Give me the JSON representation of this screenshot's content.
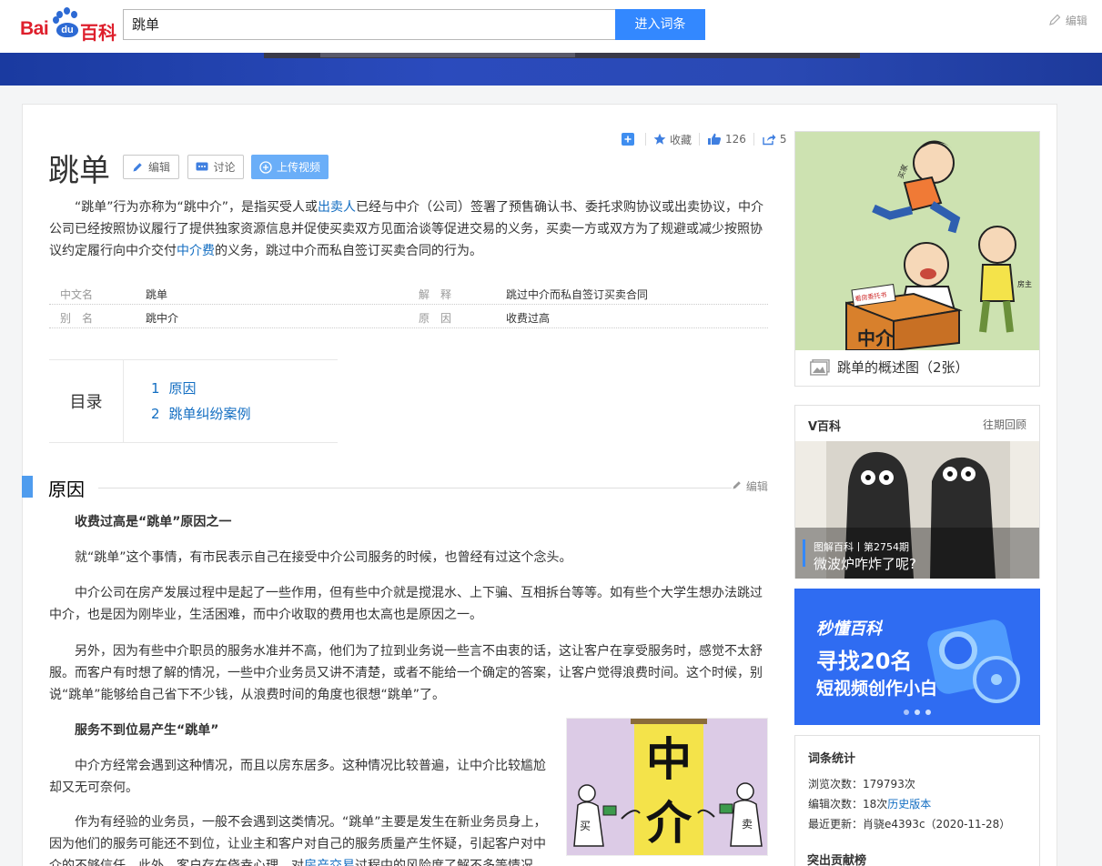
{
  "header": {
    "logo_bai": "Bai",
    "logo_du": "du",
    "logo_baike": "百科",
    "search_value": "跳单",
    "search_button": "进入词条",
    "edit_label": "编辑"
  },
  "toolbar": {
    "collect_label": "收藏",
    "like_count": "126",
    "share_count": "5"
  },
  "lemma": {
    "title": "跳单",
    "edit_button": "编辑",
    "discuss_button": "讨论",
    "upload_video_button": "上传视频"
  },
  "summary": {
    "part1": "“跳单”行为亦称为“跳中介”，是指买受人或",
    "link1": "出卖人",
    "part2": "已经与中介（公司）签署了预售确认书、委托求购协议或出卖协议，中介公司已经按照协议履行了提供独家资源信息并促使买卖双方见面洽谈等促进交易的义务，买卖一方或双方为了规避或减少按照协议约定履行向中介交付",
    "link2": "中介费",
    "part3": "的义务，跳过中介而私自签订买卖合同的行为。"
  },
  "basic_info": [
    {
      "name": "中文名",
      "value": "跳单",
      "name2": "解　释",
      "value2": "跳过中介而私自签订买卖合同"
    },
    {
      "name": "别　名",
      "value": "跳中介",
      "name2": "原　因",
      "value2": "收费过高"
    }
  ],
  "toc": {
    "label": "目录",
    "items": [
      {
        "num": "1",
        "text": "原因"
      },
      {
        "num": "2",
        "text": "跳单纠纷案例"
      }
    ]
  },
  "section": {
    "title": "原因",
    "edit_label": "编辑",
    "paragraphs": [
      {
        "text": "收费过高是“跳单”原因之一",
        "bold": true
      },
      {
        "text": "就“跳单”这个事情，有市民表示自己在接受中介公司服务的时候，也曾经有过这个念头。"
      },
      {
        "text": "中介公司在房产发展过程中是起了一些作用，但有些中介就是搅混水、上下骗、互相拆台等等。如有些个大学生想办法跳过中介，也是因为刚毕业，生活困难，而中介收取的费用也太高也是原因之一。"
      },
      {
        "text": "另外，因为有些中介职员的服务水准并不高，他们为了拉到业务说一些言不由衷的话，这让客户在享受服务时，感觉不太舒服。而客户有时想了解的情况，一些中介业务员又讲不清楚，或者不能给一个确定的答案，让客户觉得浪费时间。这个时候，别说“跳单”能够给自己省下不少钱，从浪费时间的角度也很想“跳单”了。"
      },
      {
        "text": "服务不到位易产生“跳单”",
        "bold": true
      },
      {
        "text": "中介方经常会遇到这种情况，而且以房东居多。这种情况比较普遍，让中介比较尴尬却又无可奈何。"
      },
      {
        "text_a": "作为有经验的业务员，一般不会遇到这类情况。“跳单”主要是发生在新业务员身上，因为他们的服务可能还不到位，让业主和客户对自己的服务质量产生怀疑，引起客户对中介的不够信任。此外，客户存在侥幸心理，对",
        "link": "房产交易",
        "text_b": "过程中的风险度了解不多等情况"
      }
    ],
    "image_text": {
      "top": "中",
      "bottom": "介",
      "left_person": "买",
      "right_person": "卖"
    }
  },
  "sidebar": {
    "album_caption": "跳单的概述图（2张）",
    "album_labels": {
      "buyer": "买家",
      "owner": "房主",
      "paper": "看房委托书",
      "box": "中介"
    },
    "vbaike_title": "V百科",
    "vbaike_more": "往期回顾",
    "vbaike_tag": "图解百科丨第2754期",
    "vbaike_video_title": "微波炉咋炸了呢?",
    "ad_line1": "秒懂百科",
    "ad_line2": "寻找20名",
    "ad_line3": "短视频创作小白",
    "stats_title": "词条统计",
    "views_label": "浏览次数：",
    "views_value": "179793次",
    "edits_label": "编辑次数：",
    "edits_value": "18次",
    "history_link": "历史版本",
    "updated_label": "最近更新：",
    "updated_value": "肖骁e4393c（2020-11-28）",
    "contributors_title": "突出贡献榜"
  },
  "colors": {
    "brand_red": "#de1f2c",
    "brand_blue": "#3388ff",
    "link_blue": "#136ec2",
    "section_mark": "#4f9cee"
  }
}
